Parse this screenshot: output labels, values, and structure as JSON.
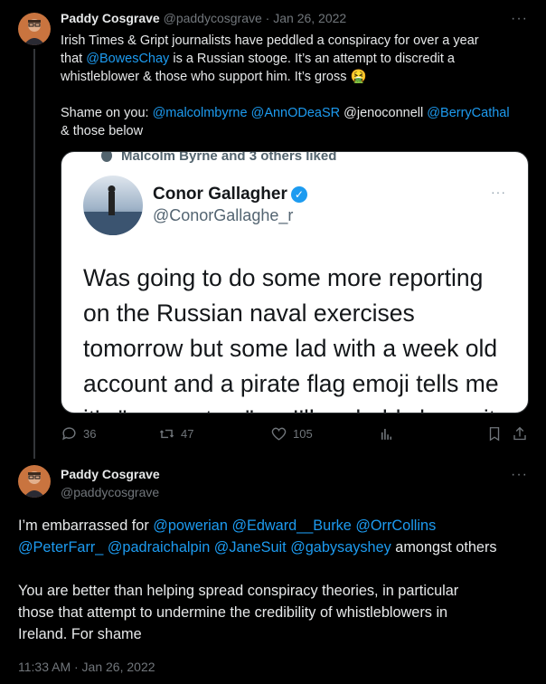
{
  "tweet1": {
    "name": "Paddy Cosgrave",
    "handle": "@paddycosgrave",
    "sep": "·",
    "date": "Jan 26, 2022",
    "more": "···",
    "line1": "Irish Times & Gript journalists have peddled a conspiracy for over a year",
    "line2_pre": "that ",
    "line2_mention": "@BowesChay",
    "line2_post": " is a Russian stooge. It’s an attempt to discredit a",
    "line3": "whistleblower & those who support him. It’s gross 🤮",
    "shame_pre": "Shame on you: ",
    "mention_a": "@malcolmbyrne",
    "mention_b": "@AnnODeaSR",
    "mention_c": "@jenoconnell",
    "mention_d": "@BerryCathal",
    "shame_post": "& those below",
    "embed": {
      "liked_by": "Malcolm Byrne and 3 others liked",
      "name": "Conor Gallagher",
      "handle": "@ConorGallaghe_r",
      "more": "···",
      "text": "Was going to do some more reporting on the Russian naval exercises tomorrow but some lad with a week old account and a pirate flag emoji tells me it's \"a non story\" so I'll probably leave it"
    },
    "actions": {
      "reply_count": "36",
      "retweet_count": "47",
      "like_count": "105"
    }
  },
  "tweet2": {
    "name": "Paddy Cosgrave",
    "handle": "@paddycosgrave",
    "more": "···",
    "p1_pre": "I’m embarrassed for ",
    "m1": "@powerian",
    "m2": "@Edward__Burke",
    "m3": "@OrrCollins",
    "m4": "@PeterFarr_",
    "m5": "@padraichalpin",
    "m6": "@JaneSuit",
    "m7": "@gabysayshey",
    "p1_post": " amongst others",
    "p2_line1": "You are better than helping spread conspiracy theories, in particular",
    "p2_line2": "those that attempt to undermine the credibility of whistleblowers in",
    "p2_line3": "Ireland. For shame",
    "timestamp": "11:33 AM · Jan 26, 2022"
  },
  "colors": {
    "background": "#000000",
    "text": "#e7e9ea",
    "muted": "#71767b",
    "link": "#1d9bf0",
    "embed_bg": "#ffffff"
  },
  "icons": [
    "reply-icon",
    "retweet-icon",
    "like-icon",
    "views-icon",
    "bookmark-icon",
    "share-icon",
    "verified-badge-icon",
    "more-icon"
  ]
}
